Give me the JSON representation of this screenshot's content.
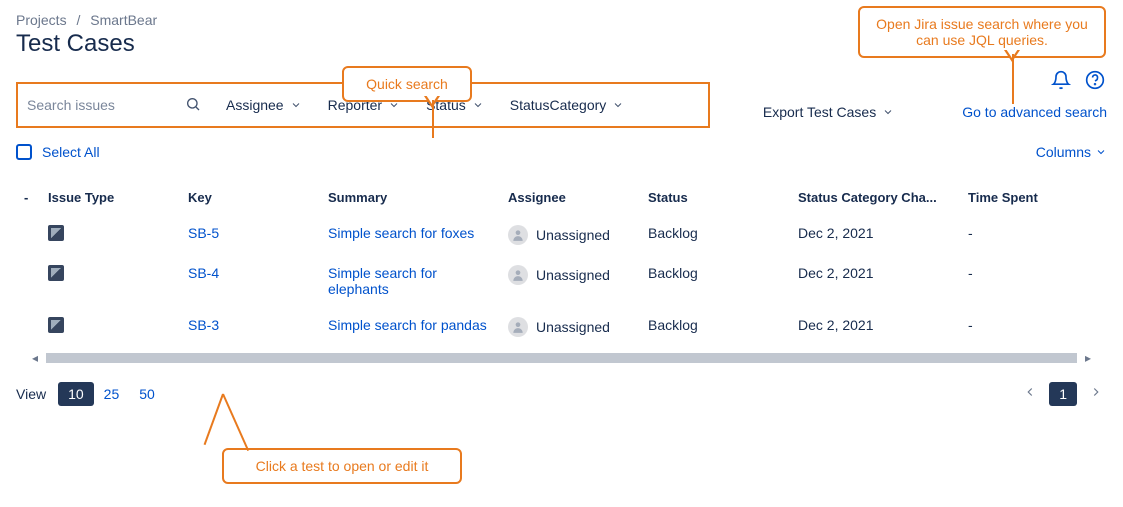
{
  "breadcrumb": {
    "root": "Projects",
    "project": "SmartBear"
  },
  "page_title": "Test Cases",
  "toolbar": {
    "export_label": "Export Test Cases",
    "advanced_search": "Go to advanced search"
  },
  "filters": {
    "search_placeholder": "Search issues",
    "assignee": "Assignee",
    "reporter": "Reporter",
    "status": "Status",
    "status_category": "StatusCategory"
  },
  "select_all": "Select All",
  "columns_label": "Columns",
  "table": {
    "headers": {
      "drag": "-",
      "issue_type": "Issue Type",
      "key": "Key",
      "summary": "Summary",
      "assignee": "Assignee",
      "status": "Status",
      "status_category_changed": "Status Category Cha...",
      "time_spent": "Time Spent"
    },
    "rows": [
      {
        "key": "SB-5",
        "summary": "Simple search for foxes",
        "assignee": "Unassigned",
        "status": "Backlog",
        "status_category_changed": "Dec 2, 2021",
        "time_spent": "-"
      },
      {
        "key": "SB-4",
        "summary": "Simple search for elephants",
        "assignee": "Unassigned",
        "status": "Backlog",
        "status_category_changed": "Dec 2, 2021",
        "time_spent": "-"
      },
      {
        "key": "SB-3",
        "summary": "Simple search for pandas",
        "assignee": "Unassigned",
        "status": "Backlog",
        "status_category_changed": "Dec 2, 2021",
        "time_spent": "-"
      }
    ]
  },
  "pagination": {
    "view_label": "View",
    "sizes": [
      "10",
      "25",
      "50"
    ],
    "active_size": "10",
    "pages": [
      "1"
    ],
    "active_page": "1"
  },
  "callouts": {
    "quick_search": "Quick search",
    "jql": "Open Jira issue search where you can use JQL queries.",
    "click_test": "Click a test to open or edit it"
  }
}
